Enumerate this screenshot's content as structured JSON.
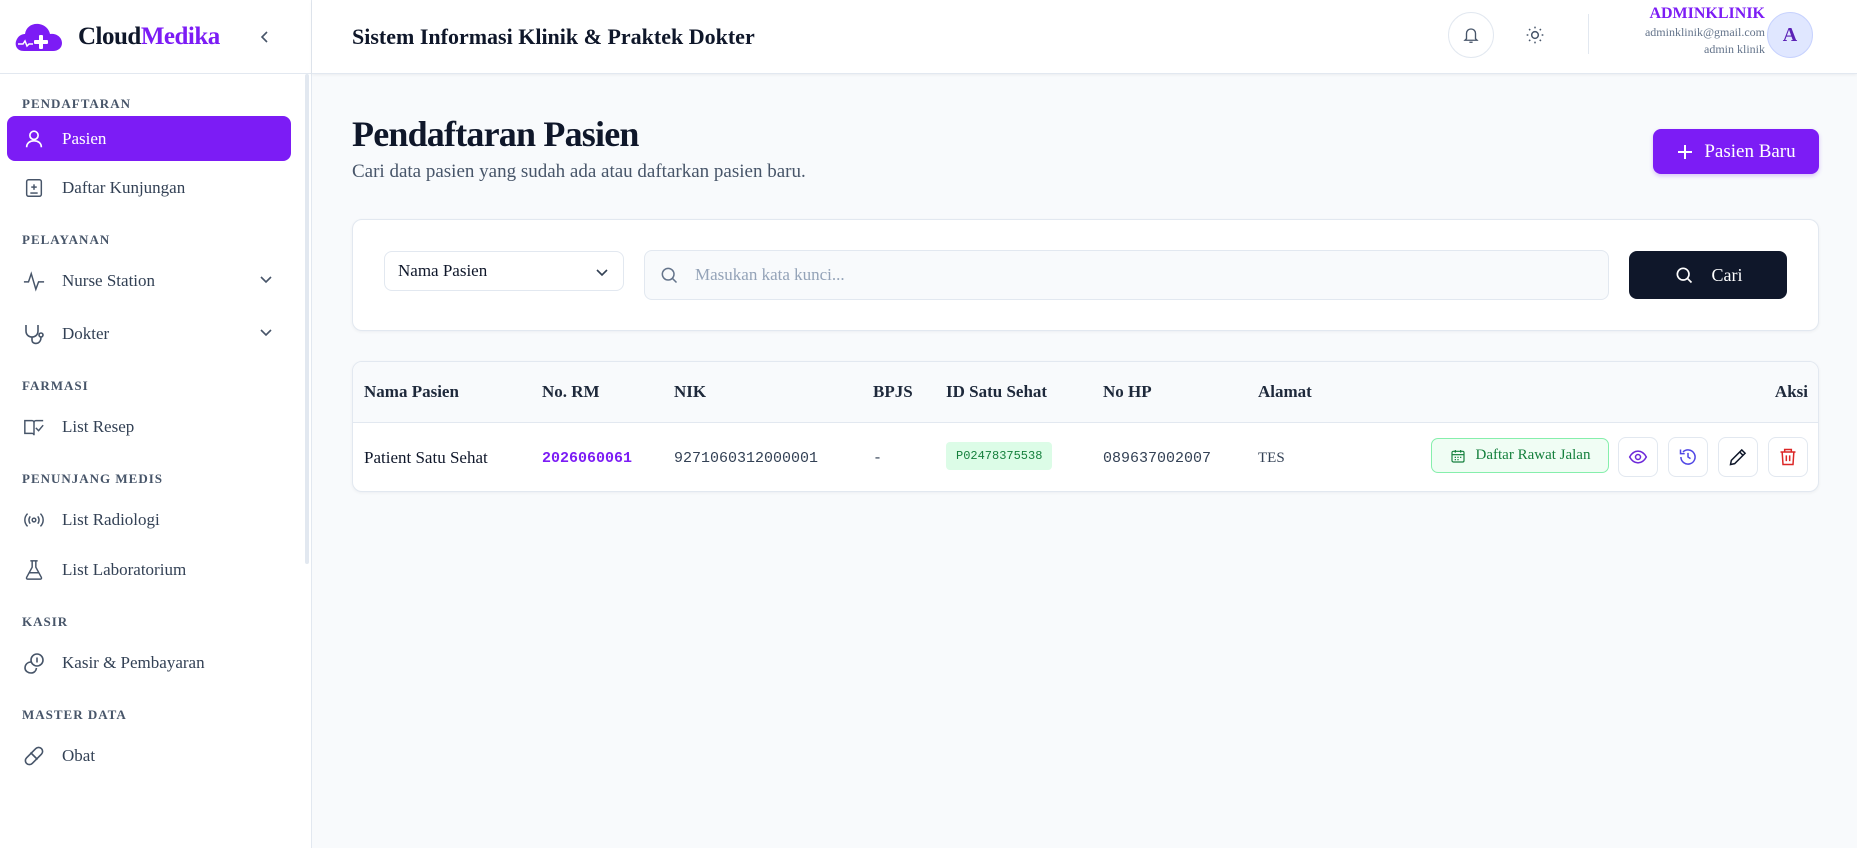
{
  "brand": {
    "part1": "Cloud",
    "part2": "Medika"
  },
  "sidebar": {
    "sections": [
      {
        "title": "PENDAFTARAN",
        "items": [
          {
            "label": "Pasien"
          },
          {
            "label": "Daftar Kunjungan"
          }
        ]
      },
      {
        "title": "PELAYANAN",
        "items": [
          {
            "label": "Nurse Station"
          },
          {
            "label": "Dokter"
          }
        ]
      },
      {
        "title": "FARMASI",
        "items": [
          {
            "label": "List Resep"
          }
        ]
      },
      {
        "title": "PENUNJANG MEDIS",
        "items": [
          {
            "label": "List Radiologi"
          },
          {
            "label": "List Laboratorium"
          }
        ]
      },
      {
        "title": "KASIR",
        "items": [
          {
            "label": "Kasir & Pembayaran"
          }
        ]
      },
      {
        "title": "MASTER DATA",
        "items": [
          {
            "label": "Obat"
          }
        ]
      }
    ]
  },
  "header": {
    "title": "Sistem Informasi Klinik & Praktek Dokter",
    "user": {
      "name": "ADMINKLINIK",
      "email": "adminklinik@gmail.com",
      "role": "admin klinik",
      "initial": "A"
    }
  },
  "main": {
    "title": "Pendaftaran Pasien",
    "subtitle": "Cari data pasien yang sudah ada atau daftarkan pasien baru.",
    "new_button": "Pasien Baru",
    "search": {
      "field_selected": "Nama Pasien",
      "placeholder": "Masukan kata kunci...",
      "button": "Cari"
    },
    "table": {
      "columns": [
        "Nama Pasien",
        "No. RM",
        "NIK",
        "BPJS",
        "ID Satu Sehat",
        "No HP",
        "Alamat",
        "Aksi"
      ],
      "rows": [
        {
          "nama": "Patient Satu Sehat",
          "rm": "2026060061",
          "nik": "9271060312000001",
          "bpjs": "-",
          "satu_sehat": "P02478375538",
          "hp": "089637002007",
          "alamat": "TES",
          "action_label": "Daftar Rawat Jalan"
        }
      ]
    }
  },
  "colors": {
    "accent": "#7c1cf5",
    "dark": "#0f172a",
    "success": "#15803d",
    "danger": "#dc2626"
  }
}
